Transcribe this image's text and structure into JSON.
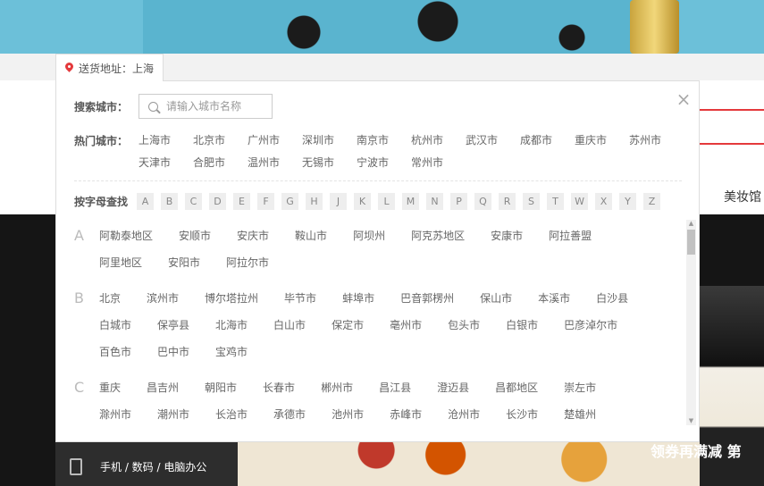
{
  "location": {
    "label": "送货地址：上海"
  },
  "search": {
    "label": "搜索城市：",
    "placeholder": "请输入城市名称"
  },
  "hot": {
    "label": "热门城市：",
    "cities": [
      "上海市",
      "北京市",
      "广州市",
      "深圳市",
      "南京市",
      "杭州市",
      "武汉市",
      "成都市",
      "重庆市",
      "苏州市",
      "天津市",
      "合肥市",
      "温州市",
      "无锡市",
      "宁波市",
      "常州市"
    ]
  },
  "letters": {
    "label": "按字母查找",
    "items": [
      "A",
      "B",
      "C",
      "D",
      "E",
      "F",
      "G",
      "H",
      "J",
      "K",
      "L",
      "M",
      "N",
      "P",
      "Q",
      "R",
      "S",
      "T",
      "W",
      "X",
      "Y",
      "Z"
    ]
  },
  "groups": [
    {
      "letter": "A",
      "cities": [
        "阿勒泰地区",
        "安顺市",
        "安庆市",
        "鞍山市",
        "阿坝州",
        "阿克苏地区",
        "安康市",
        "阿拉善盟",
        "阿里地区",
        "安阳市",
        "阿拉尔市"
      ]
    },
    {
      "letter": "B",
      "cities": [
        "北京",
        "滨州市",
        "博尔塔拉州",
        "毕节市",
        "蚌埠市",
        "巴音郭楞州",
        "保山市",
        "本溪市",
        "白沙县",
        "白城市",
        "保亭县",
        "北海市",
        "白山市",
        "保定市",
        "亳州市",
        "包头市",
        "白银市",
        "巴彦淖尔市",
        "百色市",
        "巴中市",
        "宝鸡市"
      ]
    },
    {
      "letter": "C",
      "cities": [
        "重庆",
        "昌吉州",
        "朝阳市",
        "长春市",
        "郴州市",
        "昌江县",
        "澄迈县",
        "昌都地区",
        "崇左市",
        "滁州市",
        "潮州市",
        "长治市",
        "承德市",
        "池州市",
        "赤峰市",
        "沧州市",
        "长沙市",
        "楚雄州"
      ]
    }
  ],
  "background": {
    "right_text": "美妆馆",
    "promo": "领券再满减 第",
    "category": "手机 / 数码 / 电脑办公"
  }
}
